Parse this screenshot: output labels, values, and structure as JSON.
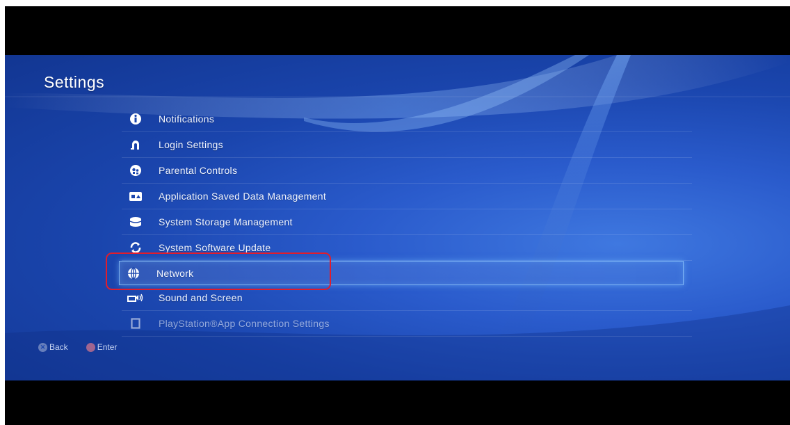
{
  "screen": {
    "title": "Settings"
  },
  "menu": {
    "items": [
      {
        "label": "Notifications",
        "icon": "info-icon"
      },
      {
        "label": "Login Settings",
        "icon": "login-icon"
      },
      {
        "label": "Parental Controls",
        "icon": "parental-icon"
      },
      {
        "label": "Application Saved Data Management",
        "icon": "saved-data-icon"
      },
      {
        "label": "System Storage Management",
        "icon": "storage-icon"
      },
      {
        "label": "System Software Update",
        "icon": "update-icon"
      },
      {
        "label": "Network",
        "icon": "globe-icon",
        "selected": true
      },
      {
        "label": "Sound and Screen",
        "icon": "sound-screen-icon"
      },
      {
        "label": "PlayStation®App Connection Settings",
        "icon": "device-icon"
      }
    ]
  },
  "footer": {
    "back_label": "Back",
    "enter_label": "Enter"
  },
  "colors": {
    "background": "#1a45ad",
    "highlight_outline": "#e11d2c",
    "selection_glow": "#96cdff"
  }
}
